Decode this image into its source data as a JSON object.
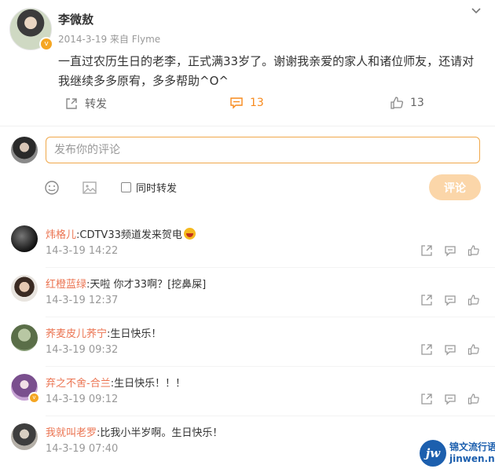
{
  "post": {
    "author": "李微敖",
    "meta": "2014-3-19  来自 Flyme",
    "content": "一直过农历生日的老李，正式满33岁了。谢谢我亲爱的家人和诸位师友，还请对我继续多多原宥，多多帮助^O^",
    "share_label": "转发",
    "comment_count": "13",
    "like_count": "13"
  },
  "composer": {
    "placeholder": "发布你的评论",
    "repost_label": "同时转发",
    "submit_label": "评论"
  },
  "comments": [
    {
      "user": "炜格儿",
      "text": ":CDTV33频道发来贺电",
      "time": "14-3-19 14:22"
    },
    {
      "user": "红橙蓝绿",
      "text": ":天啦 你才33啊？[挖鼻屎]",
      "time": "14-3-19 12:37"
    },
    {
      "user": "荞麦皮儿荞宁",
      "text": ":生日快乐！",
      "time": "14-3-19 09:32"
    },
    {
      "user": "弃之不舍-合兰",
      "text": ":生日快乐！！！",
      "time": "14-3-19 09:12"
    },
    {
      "user": "我就叫老罗",
      "text": ":比我小半岁啊。生日快乐！",
      "time": "14-3-19 07:40"
    }
  ],
  "watermark": {
    "logo": "jw",
    "line1": "锦文流行语",
    "line2": "jinwen.net"
  },
  "colors": {
    "accent": "#f78a1d",
    "username_link": "#eb7350",
    "input_border": "#f0a84a",
    "submit_bg": "#fbd6a9"
  },
  "icons": [
    "chevron-down-icon",
    "share-icon",
    "comment-icon",
    "like-icon",
    "emoji-icon",
    "image-icon",
    "verified-icon"
  ]
}
